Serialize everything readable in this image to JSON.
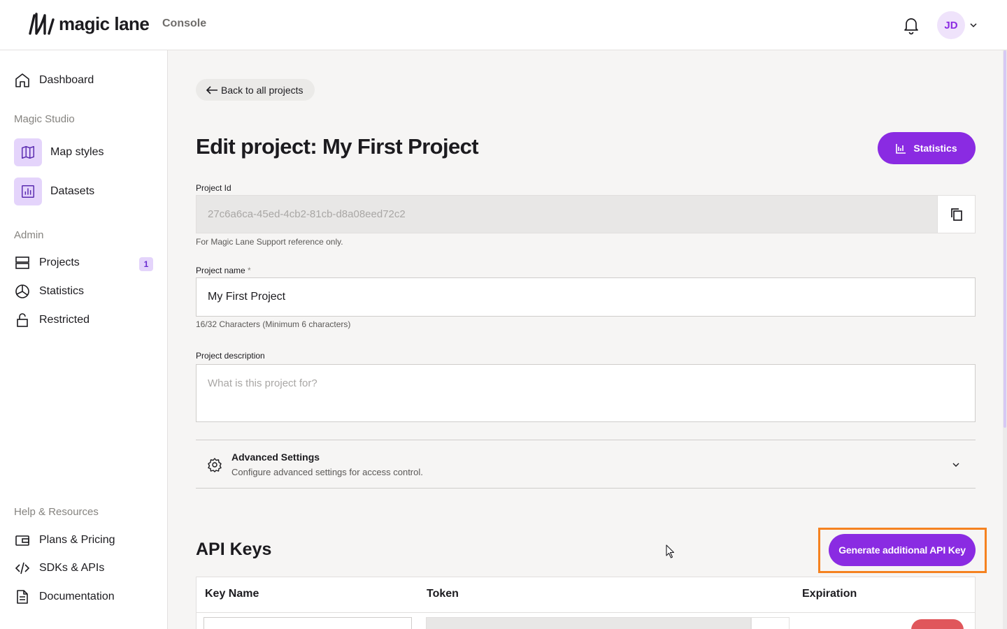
{
  "header": {
    "logo_text": "magic lane",
    "product": "Console",
    "user_initials": "JD"
  },
  "sidebar": {
    "dashboard": "Dashboard",
    "section_studio": "Magic Studio",
    "map_styles": "Map styles",
    "datasets": "Datasets",
    "section_admin": "Admin",
    "projects": "Projects",
    "projects_badge": "1",
    "statistics": "Statistics",
    "restricted": "Restricted",
    "section_help": "Help & Resources",
    "plans": "Plans & Pricing",
    "sdks": "SDKs & APIs",
    "documentation": "Documentation"
  },
  "main": {
    "back_label": "Back to all projects",
    "title": "Edit project: My First Project",
    "statistics_button": "Statistics",
    "project_id_label": "Project Id",
    "project_id_value": "27c6a6ca-45ed-4cb2-81cb-d8a08eed72c2",
    "project_id_helper": "For Magic Lane Support reference only.",
    "project_name_label": "Project name",
    "required_mark": "*",
    "project_name_value": "My First Project",
    "project_name_helper": "16/32 Characters (Minimum 6 characters)",
    "description_label": "Project description",
    "description_placeholder": "What is this project for?",
    "advanced_title": "Advanced Settings",
    "advanced_subtitle": "Configure advanced settings for access control.",
    "api_keys_title": "API Keys",
    "generate_button": "Generate additional API Key",
    "table_headers": [
      "Key Name",
      "Token",
      "Expiration"
    ]
  },
  "colors": {
    "accent": "#8a2be2",
    "highlight": "#f58220",
    "danger": "#e0565b"
  }
}
